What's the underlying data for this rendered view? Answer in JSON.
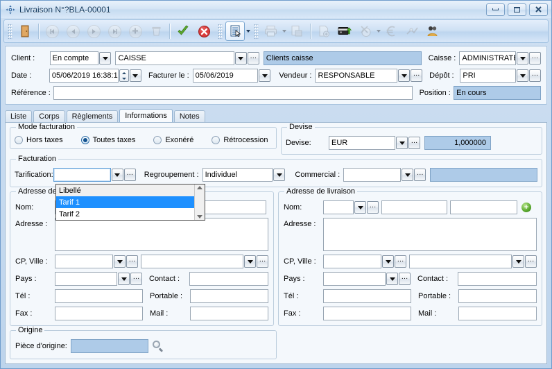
{
  "window": {
    "title": "Livraison N°?BLA-00001",
    "icon": "app-icon",
    "buttons": {
      "minimize": "minimize",
      "restore": "restore",
      "close": "close"
    }
  },
  "toolbar": {
    "groups": [
      {
        "items": [
          {
            "name": "exit-door-icon",
            "label": "Quitter",
            "enabled": true
          },
          {
            "name": "nav-first-icon",
            "label": "Premier",
            "enabled": false
          },
          {
            "name": "nav-prev-icon",
            "label": "Précédent",
            "enabled": false
          },
          {
            "name": "nav-next-icon",
            "label": "Suivant",
            "enabled": false
          },
          {
            "name": "nav-last-icon",
            "label": "Dernier",
            "enabled": false
          },
          {
            "name": "add-icon",
            "label": "Ajouter",
            "enabled": false
          },
          {
            "name": "delete-icon",
            "label": "Supprimer",
            "enabled": false
          },
          {
            "name": "validate-check-icon",
            "label": "Valider",
            "enabled": true
          },
          {
            "name": "cancel-cross-icon",
            "label": "Annuler",
            "enabled": true
          }
        ]
      },
      {
        "items": [
          {
            "name": "document-list-icon",
            "label": "Document",
            "enabled": true,
            "dropdown": true
          }
        ]
      },
      {
        "items": [
          {
            "name": "print-icon",
            "label": "Imprimer",
            "enabled": false,
            "dropdown": true
          },
          {
            "name": "copy-document-icon",
            "label": "Dupliquer",
            "enabled": false
          },
          {
            "name": "new-document-icon",
            "label": "Nouveau",
            "enabled": false
          },
          {
            "name": "card-payment-icon",
            "label": "Encaisser",
            "enabled": true
          },
          {
            "name": "discount-icon",
            "label": "Remise",
            "enabled": false,
            "dropdown": true
          },
          {
            "name": "euro-icon",
            "label": "Euro",
            "enabled": false
          },
          {
            "name": "stock-icon",
            "label": "Stock",
            "enabled": false
          },
          {
            "name": "customers-icon",
            "label": "Clients",
            "enabled": true
          }
        ]
      }
    ]
  },
  "header": {
    "client_label": "Client :",
    "client_type": "En compte",
    "client_code": "CAISSE",
    "client_name": "Clients caisse",
    "date_label": "Date :",
    "date_value": "05/06/2019 16:38:13",
    "facturer_label": "Facturer le :",
    "facturer_value": "05/06/2019",
    "vendeur_label": "Vendeur :",
    "vendeur_value": "RESPONSABLE",
    "reference_label": "Référence :",
    "reference_value": "",
    "caisse_label": "Caisse :",
    "caisse_value": "ADMINISTRATE",
    "depot_label": "Dépôt :",
    "depot_value": "PRI",
    "position_label": "Position :",
    "position_value": "En cours"
  },
  "tabs": [
    {
      "label": "Liste",
      "active": false
    },
    {
      "label": "Corps",
      "active": false
    },
    {
      "label": "Règlements",
      "active": false
    },
    {
      "label": "Informations",
      "active": true
    },
    {
      "label": "Notes",
      "active": false
    }
  ],
  "mode_facturation": {
    "title": "Mode facturation",
    "options": [
      {
        "label": "Hors taxes",
        "selected": false
      },
      {
        "label": "Toutes taxes",
        "selected": true
      },
      {
        "label": "Exonéré",
        "selected": false
      },
      {
        "label": "Rétrocession",
        "selected": false
      }
    ]
  },
  "devise": {
    "title": "Devise",
    "label": "Devise:",
    "value": "EUR",
    "rate": "1,000000"
  },
  "facturation": {
    "title": "Facturation",
    "tarification_label": "Tarification:",
    "tarification_value": "",
    "regroupement_label": "Regroupement :",
    "regroupement_value": "Individuel",
    "commercial_label": "Commercial :",
    "commercial_value": "",
    "commercial_extra": ""
  },
  "tarification_dropdown": {
    "header": "Libellé",
    "items": [
      {
        "label": "Tarif 1",
        "selected": true
      },
      {
        "label": "Tarif 2",
        "selected": false
      }
    ]
  },
  "adresse_facturation": {
    "title": "Adresse de facturation",
    "nom_label": "Nom:",
    "nom_code": "",
    "nom_value": "",
    "nom_extra": "",
    "adresse_label": "Adresse :",
    "adresse_value": "",
    "cp_ville_label": "CP, Ville :",
    "cp_value": "",
    "ville_value": "",
    "pays_label": "Pays :",
    "pays_value": "",
    "contact_label": "Contact :",
    "contact_value": "",
    "tel_label": "Tél :",
    "tel_value": "",
    "portable_label": "Portable :",
    "portable_value": "",
    "fax_label": "Fax :",
    "fax_value": "",
    "mail_label": "Mail :",
    "mail_value": ""
  },
  "adresse_livraison": {
    "title": "Adresse de livraison",
    "nom_label": "Nom:",
    "nom_code": "",
    "nom_value": "",
    "nom_extra": "",
    "add_icon": "add-address-icon",
    "adresse_label": "Adresse :",
    "adresse_value": "",
    "cp_ville_label": "CP, Ville :",
    "cp_value": "",
    "ville_value": "",
    "pays_label": "Pays :",
    "pays_value": "",
    "contact_label": "Contact :",
    "contact_value": "",
    "tel_label": "Tél :",
    "tel_value": "",
    "portable_label": "Portable :",
    "portable_value": "",
    "fax_label": "Fax :",
    "fax_value": "",
    "mail_label": "Mail :",
    "mail_value": ""
  },
  "origine": {
    "title": "Origine",
    "label": "Pièce d'origine:",
    "value": "",
    "search_icon": "magnifier-icon"
  },
  "colors": {
    "readonly_field": "#aecbe8",
    "selection": "#1e90ff",
    "panel": "#f4f8fc",
    "window_border": "#6f9ccc"
  }
}
